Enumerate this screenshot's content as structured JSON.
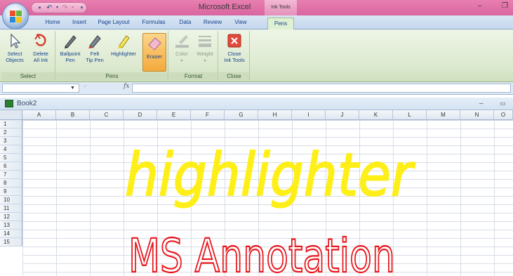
{
  "window": {
    "title": "Microsoft Excel",
    "contextual_tab_group": "Ink Tools",
    "minimize": "–",
    "restore": "❐"
  },
  "tabs": [
    {
      "label": "Home"
    },
    {
      "label": "Insert"
    },
    {
      "label": "Page Layout"
    },
    {
      "label": "Formulas"
    },
    {
      "label": "Data"
    },
    {
      "label": "Review"
    },
    {
      "label": "View"
    },
    {
      "label": "Pens",
      "active": true
    }
  ],
  "ribbon": {
    "groups": {
      "select": {
        "label": "Select",
        "buttons": [
          {
            "label_line1": "Select",
            "label_line2": "Objects",
            "icon": "cursor-arrow-icon"
          },
          {
            "label_line1": "Delete",
            "label_line2": "All Ink",
            "icon": "delete-ink-icon"
          }
        ]
      },
      "pens": {
        "label": "Pens",
        "buttons": [
          {
            "label_line1": "Ballpoint",
            "label_line2": "Pen",
            "icon": "ballpoint-pen-icon"
          },
          {
            "label_line1": "Felt",
            "label_line2": "Tip Pen",
            "icon": "felt-tip-pen-icon"
          },
          {
            "label_line1": "Highlighter",
            "label_line2": "",
            "icon": "highlighter-icon"
          },
          {
            "label_line1": "Eraser",
            "label_line2": "",
            "icon": "eraser-icon",
            "selected": true
          }
        ]
      },
      "format": {
        "label": "Format",
        "buttons": [
          {
            "label_line1": "Color",
            "label_line2": "",
            "icon": "color-icon"
          },
          {
            "label_line1": "Weight",
            "label_line2": "",
            "icon": "weight-icon"
          }
        ]
      },
      "close": {
        "label": "Close",
        "buttons": [
          {
            "label_line1": "Close",
            "label_line2": "Ink Tools",
            "icon": "close-ink-tools-icon"
          }
        ]
      }
    }
  },
  "formula_bar": {
    "name_box_value": "",
    "fx_label": "fx",
    "formula_value": ""
  },
  "workbook": {
    "name": "Book2",
    "minimize": "–",
    "restore": "▭"
  },
  "grid": {
    "columns": [
      "A",
      "B",
      "C",
      "D",
      "E",
      "F",
      "G",
      "H",
      "I",
      "J",
      "K",
      "L",
      "M",
      "N",
      "O"
    ],
    "rows": [
      "1",
      "2",
      "3",
      "4",
      "5",
      "6",
      "7",
      "8",
      "9",
      "10",
      "11",
      "12",
      "13",
      "14",
      "15"
    ]
  },
  "ink": {
    "highlighter_text": "highlighter",
    "highlighter_color": "#ffee00",
    "pen_text": "MS Annotation",
    "pen_color": "#e8161b"
  },
  "colors": {
    "title_bar": "#e07fb0",
    "contextual_tab": "#e9a6c8",
    "ribbon": "#dce9cf"
  }
}
